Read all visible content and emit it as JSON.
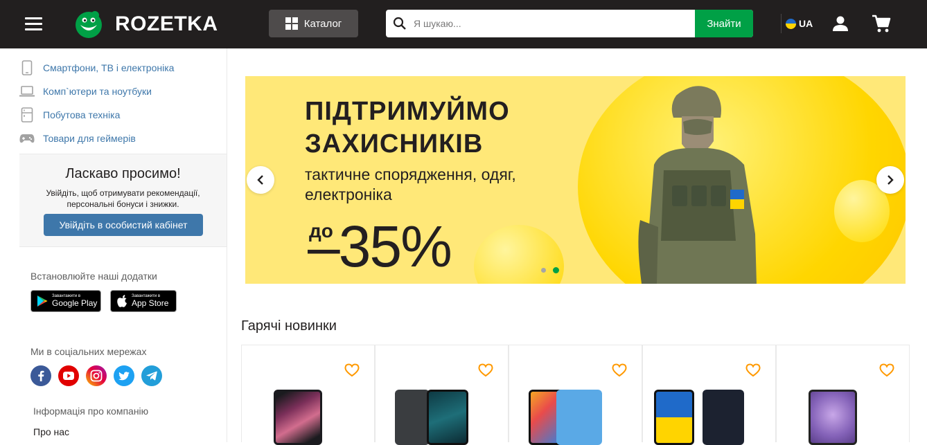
{
  "header": {
    "logo_text": "ROZETKA",
    "catalog_label": "Каталог",
    "search_placeholder": "Я шукаю...",
    "search_button": "Знайти",
    "language": "UA",
    "icons": [
      "menu-icon",
      "catalog-grid-icon",
      "search-icon",
      "user-icon",
      "cart-icon"
    ]
  },
  "sidebar": {
    "categories": [
      {
        "label": "Смартфони, ТВ і електроніка",
        "icon": "smartphone-icon"
      },
      {
        "label": "Комп`ютери та ноутбуки",
        "icon": "laptop-icon"
      },
      {
        "label": "Побутова техніка",
        "icon": "appliance-icon"
      },
      {
        "label": "Товари для геймерів",
        "icon": "gamepad-icon"
      }
    ],
    "welcome": {
      "title": "Ласкаво просимо!",
      "text": "Увійдіть, щоб отримувати рекомендації, персональні бонуси і знижки.",
      "button": "Увійдіть в особистий кабінет"
    },
    "apps": {
      "title": "Встановлюйте наші додатки",
      "google_small": "Завантажити в",
      "google_big": "Google Play",
      "apple_small": "Завантажити в",
      "apple_big": "App Store"
    },
    "social_title": "Ми в соціальних мережах",
    "social": [
      "facebook-icon",
      "youtube-icon",
      "instagram-icon",
      "twitter-icon",
      "telegram-icon"
    ],
    "info_title": "Інформація про компанію",
    "about_link": "Про нас"
  },
  "banner": {
    "line1": "ПІДТРИМУЙМО",
    "line2": "ЗАХИСНИКІВ",
    "subtitle": "тактичне спорядження, одяг, електроніка",
    "prefix": "до",
    "discount": "–35%",
    "slides_total": 2,
    "active_slide": 2
  },
  "section": {
    "title": "Гарячі новинки",
    "product_count": 5
  },
  "colors": {
    "header_bg": "#221f1f",
    "accent_green": "#00a046",
    "link_blue": "#3e77aa",
    "banner_yellow": "#ffe878",
    "heart_orange": "#ff9900"
  }
}
